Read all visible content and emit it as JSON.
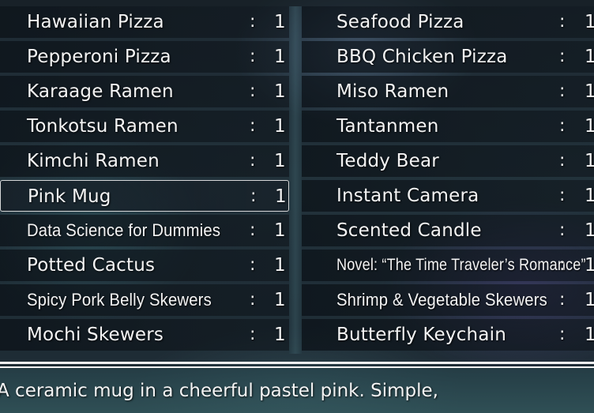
{
  "inventory": {
    "left_column": [
      {
        "name": "Hawaiian Pizza",
        "separator": ":",
        "quantity": "1"
      },
      {
        "name": "Pepperoni Pizza",
        "separator": ":",
        "quantity": "1"
      },
      {
        "name": "Karaage Ramen",
        "separator": ":",
        "quantity": "1"
      },
      {
        "name": "Tonkotsu Ramen",
        "separator": ":",
        "quantity": "1"
      },
      {
        "name": "Kimchi Ramen",
        "separator": ":",
        "quantity": "1"
      },
      {
        "name": "Pink Mug",
        "separator": ":",
        "quantity": "1"
      },
      {
        "name": "Data Science for Dummies",
        "separator": ":",
        "quantity": "1"
      },
      {
        "name": "Potted Cactus",
        "separator": ":",
        "quantity": "1"
      },
      {
        "name": "Spicy Pork Belly Skewers",
        "separator": ":",
        "quantity": "1"
      },
      {
        "name": "Mochi Skewers",
        "separator": ":",
        "quantity": "1"
      }
    ],
    "right_column": [
      {
        "name": "Seafood Pizza",
        "separator": ":",
        "quantity": "1"
      },
      {
        "name": "BBQ Chicken Pizza",
        "separator": ":",
        "quantity": "1"
      },
      {
        "name": "Miso Ramen",
        "separator": ":",
        "quantity": "1"
      },
      {
        "name": "Tantanmen",
        "separator": ":",
        "quantity": "1"
      },
      {
        "name": "Teddy Bear",
        "separator": ":",
        "quantity": "1"
      },
      {
        "name": "Instant Camera",
        "separator": ":",
        "quantity": "1"
      },
      {
        "name": "Scented Candle",
        "separator": ":",
        "quantity": "1"
      },
      {
        "name": "Novel: “The Time Traveler’s Romance”",
        "separator": ":",
        "quantity": "1"
      },
      {
        "name": "Shrimp & Vegetable Skewers",
        "separator": ":",
        "quantity": "1"
      },
      {
        "name": "Butterfly Keychain",
        "separator": ":",
        "quantity": "1"
      }
    ],
    "selected_item": "Pink Mug"
  },
  "description": {
    "text": "A ceramic mug in a cheerful pastel pink. Simple,"
  }
}
